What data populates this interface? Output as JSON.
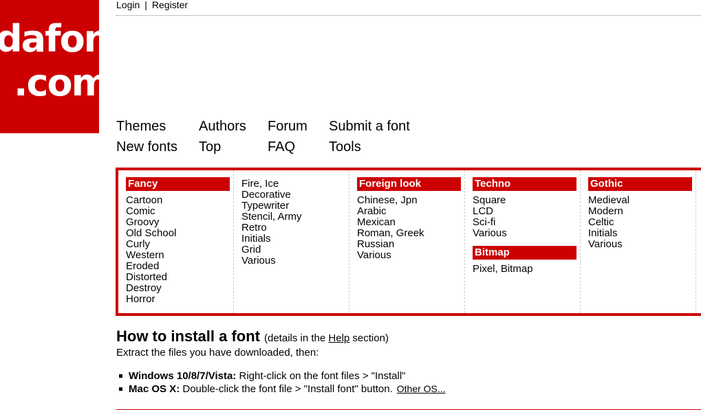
{
  "logo": {
    "line1": "dafont",
    "line2": ".com"
  },
  "userbar": {
    "login": "Login",
    "separator": "|",
    "register": "Register"
  },
  "nav": {
    "themes": "Themes",
    "authors": "Authors",
    "forum": "Forum",
    "submit": "Submit a font",
    "new_fonts": "New fonts",
    "top": "Top",
    "faq": "FAQ",
    "tools": "Tools"
  },
  "categories": {
    "fancy": {
      "title": "Fancy",
      "items": [
        "Cartoon",
        "Comic",
        "Groovy",
        "Old School",
        "Curly",
        "Western",
        "Eroded",
        "Distorted",
        "Destroy",
        "Horror"
      ]
    },
    "fancy2": {
      "items": [
        "Fire, Ice",
        "Decorative",
        "Typewriter",
        "Stencil, Army",
        "Retro",
        "Initials",
        "Grid",
        "Various"
      ]
    },
    "foreign": {
      "title": "Foreign look",
      "items": [
        "Chinese, Jpn",
        "Arabic",
        "Mexican",
        "Roman, Greek",
        "Russian",
        "Various"
      ]
    },
    "techno": {
      "title": "Techno",
      "items": [
        "Square",
        "LCD",
        "Sci-fi",
        "Various"
      ]
    },
    "bitmap": {
      "title": "Bitmap",
      "items": [
        "Pixel, Bitmap"
      ]
    },
    "gothic": {
      "title": "Gothic",
      "items": [
        "Medieval",
        "Modern",
        "Celtic",
        "Initials",
        "Various"
      ]
    }
  },
  "install": {
    "title": "How to install a font",
    "details_prefix": "(details in the",
    "details_link": "Help",
    "details_suffix": "section)",
    "extract": "Extract the files you have downloaded, then:",
    "windows_label": "Windows 10/8/7/Vista:",
    "windows_text": "Right-click on the font files > \"Install\"",
    "mac_label": "Mac OS X:",
    "mac_text": "Double-click the font file > \"Install font\" button.",
    "other_os": "Other OS..."
  },
  "colors": {
    "brand_red": "#cc0000",
    "divider": "#cccccc"
  }
}
